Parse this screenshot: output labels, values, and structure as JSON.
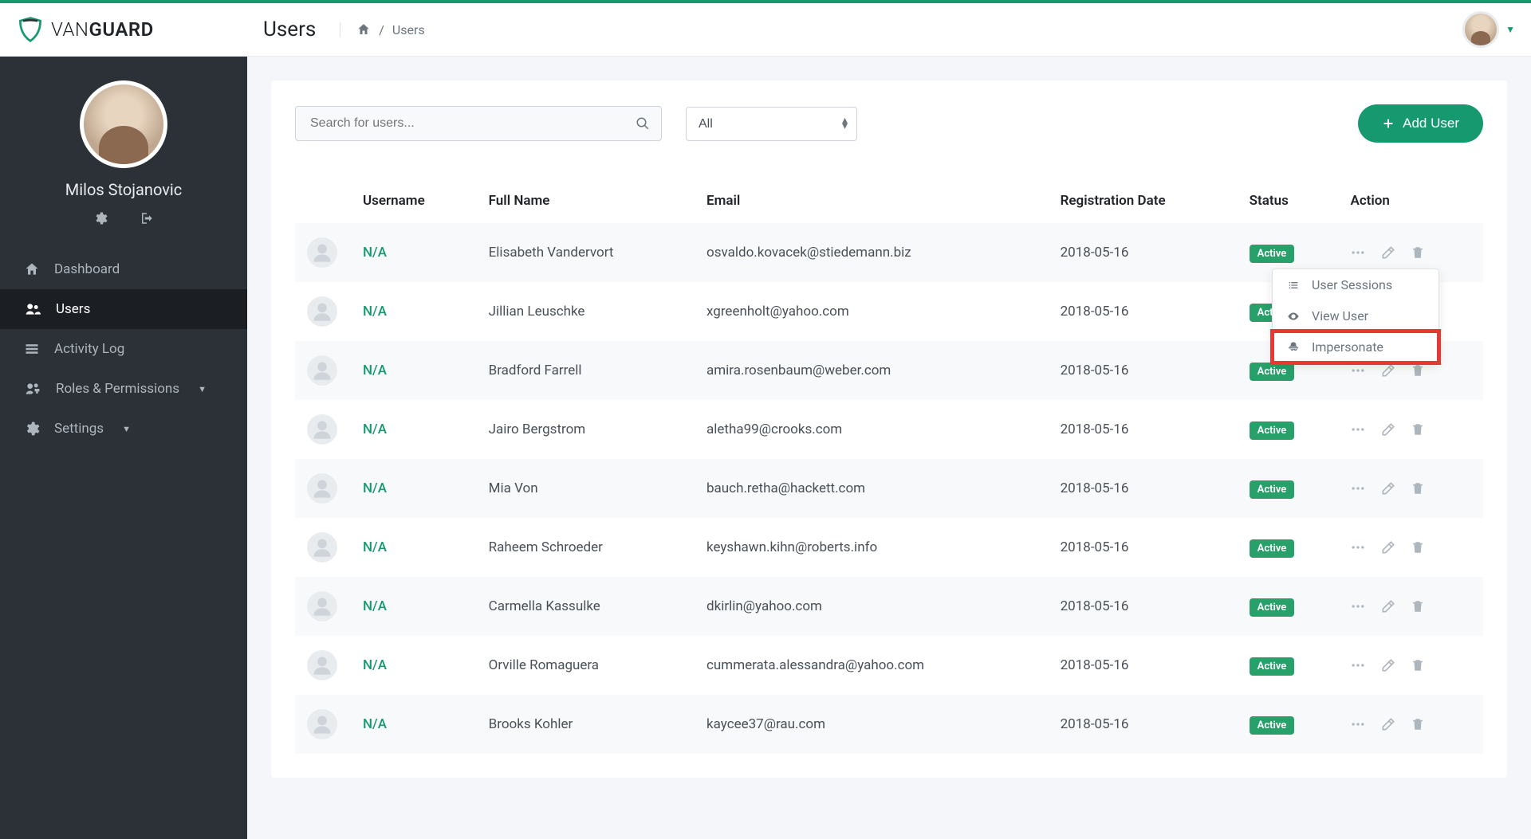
{
  "brand": {
    "pre": "VAN",
    "bold": "GUARD"
  },
  "header": {
    "page_title": "Users",
    "breadcrumb_current": "Users"
  },
  "user": {
    "name": "Milos Stojanovic"
  },
  "sidebar": {
    "items": [
      {
        "label": "Dashboard",
        "icon": "home",
        "chev": false
      },
      {
        "label": "Users",
        "icon": "users",
        "chev": false,
        "active": true
      },
      {
        "label": "Activity Log",
        "icon": "list",
        "chev": false
      },
      {
        "label": "Roles & Permissions",
        "icon": "key",
        "chev": true
      },
      {
        "label": "Settings",
        "icon": "gears",
        "chev": true
      }
    ]
  },
  "filters": {
    "search_placeholder": "Search for users...",
    "status_selected": "All",
    "add_label": "Add User"
  },
  "table": {
    "columns": [
      "Username",
      "Full Name",
      "Email",
      "Registration Date",
      "Status",
      "Action"
    ],
    "na": "N/A",
    "status_active": "Active",
    "rows": [
      {
        "full_name": "Elisabeth Vandervort",
        "email": "osvaldo.kovacek@stiedemann.biz",
        "date": "2018-05-16"
      },
      {
        "full_name": "Jillian Leuschke",
        "email": "xgreenholt@yahoo.com",
        "date": "2018-05-16"
      },
      {
        "full_name": "Bradford Farrell",
        "email": "amira.rosenbaum@weber.com",
        "date": "2018-05-16"
      },
      {
        "full_name": "Jairo Bergstrom",
        "email": "aletha99@crooks.com",
        "date": "2018-05-16"
      },
      {
        "full_name": "Mia Von",
        "email": "bauch.retha@hackett.com",
        "date": "2018-05-16"
      },
      {
        "full_name": "Raheem Schroeder",
        "email": "keyshawn.kihn@roberts.info",
        "date": "2018-05-16"
      },
      {
        "full_name": "Carmella Kassulke",
        "email": "dkirlin@yahoo.com",
        "date": "2018-05-16"
      },
      {
        "full_name": "Orville Romaguera",
        "email": "cummerata.alessandra@yahoo.com",
        "date": "2018-05-16"
      },
      {
        "full_name": "Brooks Kohler",
        "email": "kaycee37@rau.com",
        "date": "2018-05-16"
      }
    ]
  },
  "dropdown": {
    "items": [
      {
        "label": "User Sessions"
      },
      {
        "label": "View User"
      },
      {
        "label": "Impersonate"
      }
    ]
  }
}
